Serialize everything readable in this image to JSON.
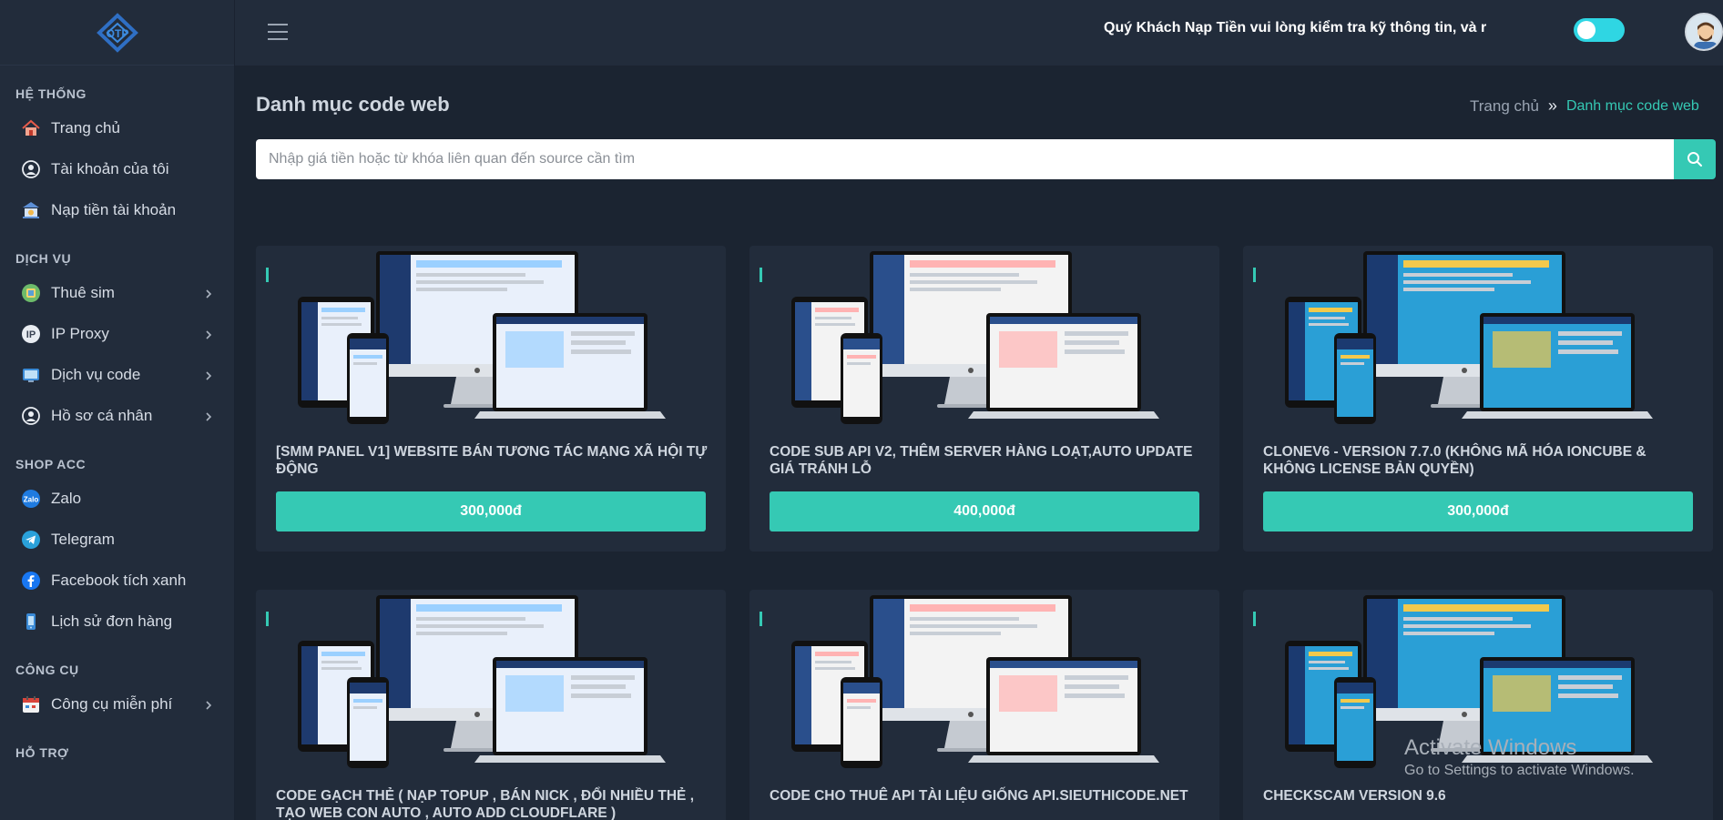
{
  "sidebar": {
    "sections": [
      {
        "title": "HỆ THỐNG",
        "items": [
          {
            "label": "Trang chủ",
            "icon": "home-icon"
          },
          {
            "label": "Tài khoản của tôi",
            "icon": "user-icon"
          },
          {
            "label": "Nạp tiền tài khoản",
            "icon": "bank-icon"
          }
        ]
      },
      {
        "title": "DỊCH VỤ",
        "items": [
          {
            "label": "Thuê sim",
            "icon": "sim-icon",
            "chevron": true
          },
          {
            "label": "IP Proxy",
            "icon": "proxy-icon",
            "chevron": true
          },
          {
            "label": "Dịch vụ code",
            "icon": "code-icon",
            "chevron": true
          },
          {
            "label": "Hồ sơ cá nhân",
            "icon": "profile-icon",
            "chevron": true
          }
        ]
      },
      {
        "title": "SHOP ACC",
        "items": [
          {
            "label": "Zalo",
            "icon": "zalo-icon"
          },
          {
            "label": "Telegram",
            "icon": "telegram-icon"
          },
          {
            "label": "Facebook tích xanh",
            "icon": "facebook-icon"
          },
          {
            "label": "Lịch sử đơn hàng",
            "icon": "history-icon"
          }
        ]
      },
      {
        "title": "CÔNG CỤ",
        "items": [
          {
            "label": "Công cụ miễn phí",
            "icon": "calendar-icon",
            "chevron": true
          }
        ]
      },
      {
        "title": "HỖ TRỢ",
        "items": []
      }
    ]
  },
  "header": {
    "marquee": "Quý Khách Nạp Tiền vui lòng kiểm tra kỹ thông tin, và r",
    "toggle_on": true
  },
  "main": {
    "title": "Danh mục code web",
    "breadcrumb": {
      "home": "Trang chủ",
      "separator": "»",
      "current": "Danh mục code web"
    },
    "search_placeholder": "Nhập giá tiền hoặc từ khóa liên quan đến source cần tìm",
    "cards": [
      {
        "title": "[SMM PANEL V1] WEBSITE BÁN TƯƠNG TÁC MẠNG XÃ HỘI TỰ ĐỘNG",
        "price": "300,000đ"
      },
      {
        "title": "CODE SUB API V2, THÊM SERVER HÀNG LOẠT,AUTO UPDATE GIÁ TRÁNH LỖ",
        "price": "400,000đ"
      },
      {
        "title": "CLONEV6 - VERSION 7.7.0 (KHÔNG MÃ HÓA IONCUBE & KHÔNG LICENSE BẢN QUYỀN)",
        "price": "300,000đ"
      },
      {
        "title": "CODE GẠCH THẺ ( NẠP TOPUP , BÁN NICK , ĐỔI NHIỀU THẺ , TẠO WEB CON AUTO , AUTO ADD CLOUDFLARE )",
        "price": ""
      },
      {
        "title": "CODE CHO THUÊ API TÀI LIỆU GIỐNG API.SIEUTHICODE.NET",
        "price": ""
      },
      {
        "title": "CHECKSCAM VERSION 9.6",
        "price": ""
      }
    ]
  },
  "watermark": {
    "line1": "Activate Windows",
    "line2": "Go to Settings to activate Windows."
  },
  "colors": {
    "accent": "#35c9b4",
    "sidebar": "#222c3b",
    "background": "#1b2431",
    "toggle": "#2fd6e3"
  }
}
